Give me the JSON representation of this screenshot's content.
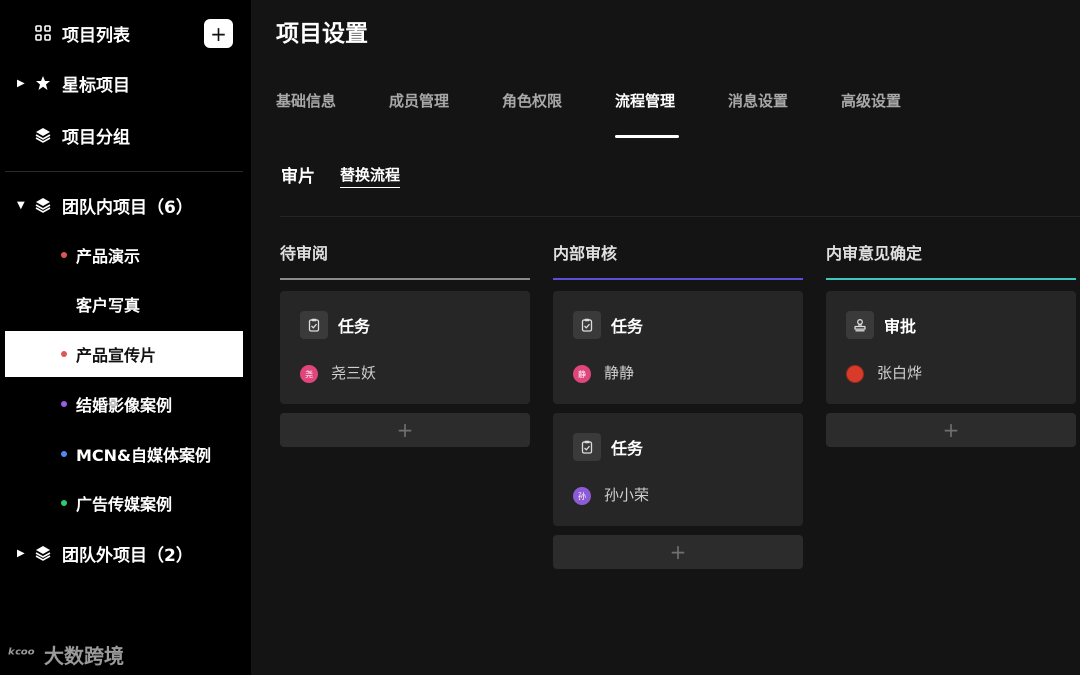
{
  "sidebar": {
    "project_list": "项目列表",
    "add_label": "+",
    "starred": "星标项目",
    "groups": "项目分组",
    "team_inner": "团队内项目（6）",
    "team_outer": "团队外项目（2）",
    "projects": [
      {
        "label": "产品演示",
        "dot": "#e05656"
      },
      {
        "label": "客户写真",
        "dot": ""
      },
      {
        "label": "产品宣传片",
        "dot": "#e05656"
      },
      {
        "label": "结婚影像案例",
        "dot": "#9b5de5"
      },
      {
        "label": "MCN&自媒体案例",
        "dot": "#4d8cf5"
      },
      {
        "label": "广告传媒案例",
        "dot": "#2ecc71"
      }
    ],
    "active_index": 2
  },
  "watermark": {
    "logo": "ᵏᶜᵒᵒ",
    "text": "大数跨境"
  },
  "main": {
    "title": "项目设置",
    "tabs": [
      "基础信息",
      "成员管理",
      "角色权限",
      "流程管理",
      "消息设置",
      "高级设置"
    ],
    "active_tab": 3,
    "subtabs": [
      "审片",
      "替换流程"
    ],
    "columns": [
      {
        "title": "待审阅",
        "line_color": "#8a8a8a",
        "cards": [
          {
            "label": "任务",
            "icon": "clipboard-icon",
            "user": "尧三妖",
            "avatar_text": "尧",
            "avatar_color": "#e0457b"
          }
        ],
        "add_label": "+"
      },
      {
        "title": "内部审核",
        "line_color": "#5b4fd9",
        "cards": [
          {
            "label": "任务",
            "icon": "clipboard-icon",
            "user": "静静",
            "avatar_text": "静",
            "avatar_color": "#e0457b"
          },
          {
            "label": "任务",
            "icon": "clipboard-icon",
            "user": "孙小荣",
            "avatar_text": "孙",
            "avatar_color": "#8e5bd6"
          }
        ],
        "add_label": "+"
      },
      {
        "title": "内审意见确定",
        "line_color": "#3fc6c0",
        "cards": [
          {
            "label": "审批",
            "icon": "stamp-icon",
            "user": "张白烨",
            "avatar_text": "",
            "avatar_color": "#d93b2b"
          }
        ],
        "add_label": "+"
      }
    ]
  }
}
